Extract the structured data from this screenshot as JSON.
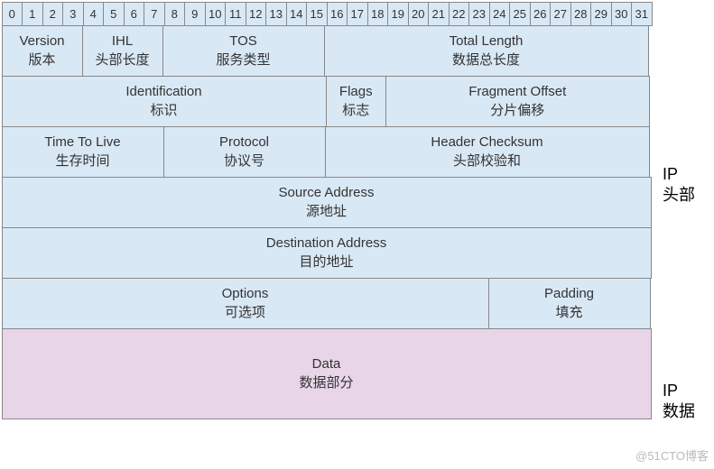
{
  "bits": [
    "0",
    "1",
    "2",
    "3",
    "4",
    "5",
    "6",
    "7",
    "8",
    "9",
    "10",
    "11",
    "12",
    "13",
    "14",
    "15",
    "16",
    "17",
    "18",
    "19",
    "20",
    "21",
    "22",
    "23",
    "24",
    "25",
    "26",
    "27",
    "28",
    "29",
    "30",
    "31"
  ],
  "rows": [
    [
      {
        "w": "w4",
        "en": "Version",
        "cn": "版本"
      },
      {
        "w": "w4",
        "en": "IHL",
        "cn": "头部长度"
      },
      {
        "w": "w8",
        "en": "TOS",
        "cn": "服务类型"
      },
      {
        "w": "w16",
        "en": "Total Length",
        "cn": "数据总长度"
      }
    ],
    [
      {
        "w": "w16",
        "en": "Identification",
        "cn": "标识"
      },
      {
        "w": "w3",
        "en": "Flags",
        "cn": "标志"
      },
      {
        "w": "w13",
        "en": "Fragment Offset",
        "cn": "分片偏移"
      }
    ],
    [
      {
        "w": "w8",
        "en": "Time To Live",
        "cn": "生存时间"
      },
      {
        "w": "w8",
        "en": "Protocol",
        "cn": "协议号"
      },
      {
        "w": "w16",
        "en": "Header Checksum",
        "cn": "头部校验和"
      }
    ],
    [
      {
        "w": "w32",
        "en": "Source Address",
        "cn": "源地址"
      }
    ],
    [
      {
        "w": "w32",
        "en": "Destination Address",
        "cn": "目的地址"
      }
    ],
    [
      {
        "w": "w24",
        "en": "Options",
        "cn": "可选项"
      },
      {
        "w": "w8",
        "en": "Padding",
        "cn": "填充"
      }
    ]
  ],
  "data_field": {
    "en": "Data",
    "cn": "数据部分"
  },
  "side": {
    "header": "IP\n头部",
    "data": "IP\n数据"
  },
  "watermark": "@51CTO博客"
}
